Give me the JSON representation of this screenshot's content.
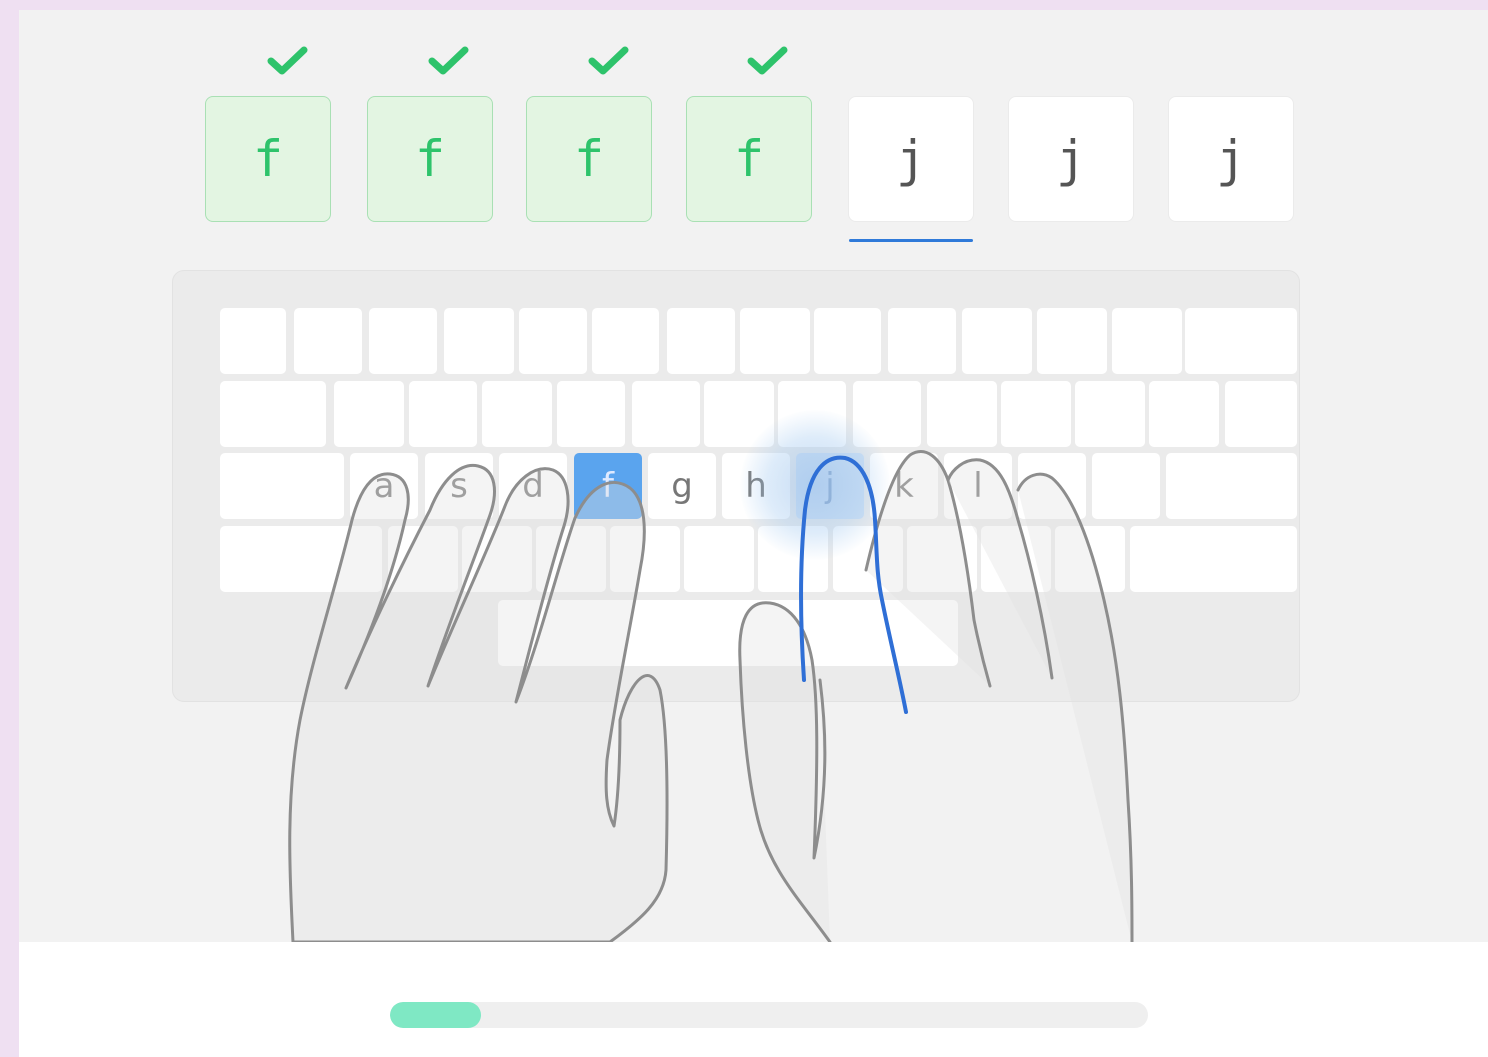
{
  "lesson": {
    "sequence": [
      {
        "char": "f",
        "state": "correct"
      },
      {
        "char": "f",
        "state": "correct"
      },
      {
        "char": "f",
        "state": "correct"
      },
      {
        "char": "f",
        "state": "correct"
      },
      {
        "char": "j",
        "state": "current"
      },
      {
        "char": "j",
        "state": "pending"
      },
      {
        "char": "j",
        "state": "pending"
      }
    ],
    "correct_icon": "checkmark-icon"
  },
  "keyboard": {
    "home_row_labels": [
      "a",
      "s",
      "d",
      "f",
      "g",
      "h",
      "j",
      "k",
      "l"
    ],
    "highlighted_key": "f",
    "next_key": "j"
  },
  "hands": {
    "guide_finger": "right-index"
  },
  "progress": {
    "fraction": 0.12
  },
  "colors": {
    "correct": "#2ec36b",
    "correct_bg": "#e3f5e2",
    "cursor": "#2f7ad9",
    "highlight_key": "#5aa4ee",
    "guide_finger": "#2f6fd6",
    "progress_fill": "#7fe8c4",
    "frame_bg": "#efe0f2"
  }
}
